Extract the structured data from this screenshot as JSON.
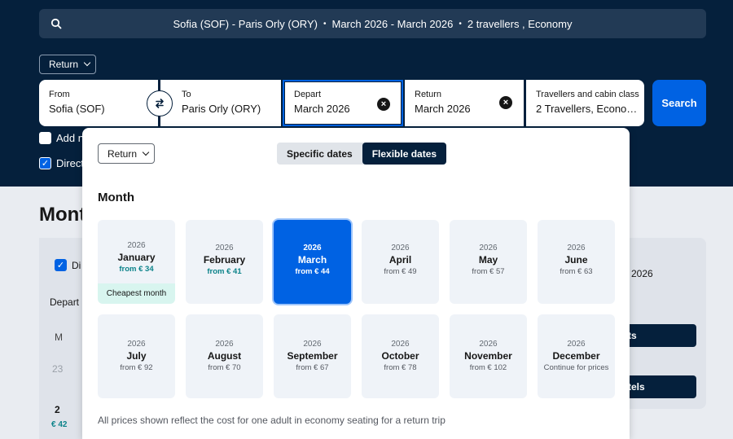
{
  "summary": {
    "route": "Sofia (SOF) - Paris Orly (ORY)",
    "dates": "March 2026 - March 2026",
    "travellers": "2 travellers , Economy",
    "separator": "•"
  },
  "search_form": {
    "trip_type": "Return",
    "from_label": "From",
    "from_value": "Sofia (SOF)",
    "to_label": "To",
    "to_value": "Paris Orly (ORY)",
    "depart_label": "Depart",
    "depart_value": "March 2026",
    "return_label": "Return",
    "return_value": "March 2026",
    "travellers_label": "Travellers and cabin class",
    "travellers_value": "2 Travellers, Economy",
    "search_label": "Search",
    "add_nearby_label": "Add n",
    "direct_label": "Direct"
  },
  "background": {
    "title": "Mont",
    "direct_label": "Di",
    "depart_label": "Depart",
    "weekday": "M",
    "day_prev": "23",
    "day": "2",
    "day_price": "€ 42",
    "right_text": "2026",
    "btn1": "ts",
    "btn2": "tels"
  },
  "popover": {
    "trip_type": "Return",
    "tabs": [
      "Specific dates",
      "Flexible dates"
    ],
    "active_tab": "Flexible dates",
    "heading": "Month",
    "months": [
      {
        "year": "2026",
        "month": "January",
        "price": "from € 34",
        "badge": "Cheapest month"
      },
      {
        "year": "2026",
        "month": "February",
        "price": "from € 41"
      },
      {
        "year": "2026",
        "month": "March",
        "price": "from € 44",
        "selected": true
      },
      {
        "year": "2026",
        "month": "April",
        "price": "from € 49"
      },
      {
        "year": "2026",
        "month": "May",
        "price": "from € 57"
      },
      {
        "year": "2026",
        "month": "June",
        "price": "from € 63"
      },
      {
        "year": "2026",
        "month": "July",
        "price": "from € 92"
      },
      {
        "year": "2026",
        "month": "August",
        "price": "from € 70"
      },
      {
        "year": "2026",
        "month": "September",
        "price": "from € 67"
      },
      {
        "year": "2026",
        "month": "October",
        "price": "from € 78"
      },
      {
        "year": "2026",
        "month": "November",
        "price": "from € 102"
      },
      {
        "year": "2026",
        "month": "December",
        "price": "Continue for prices"
      }
    ],
    "footnote": "All prices shown reflect the cost for one adult in economy seating for a return trip"
  },
  "colors": {
    "header_bg": "#05203c",
    "accent": "#0062e3",
    "cheapest_badge": "#d8f5ef"
  },
  "icons": {
    "search": "search-icon",
    "swap": "swap-icon",
    "clear": "clear-icon",
    "chevron": "chevron-down-icon",
    "check": "check-icon"
  }
}
